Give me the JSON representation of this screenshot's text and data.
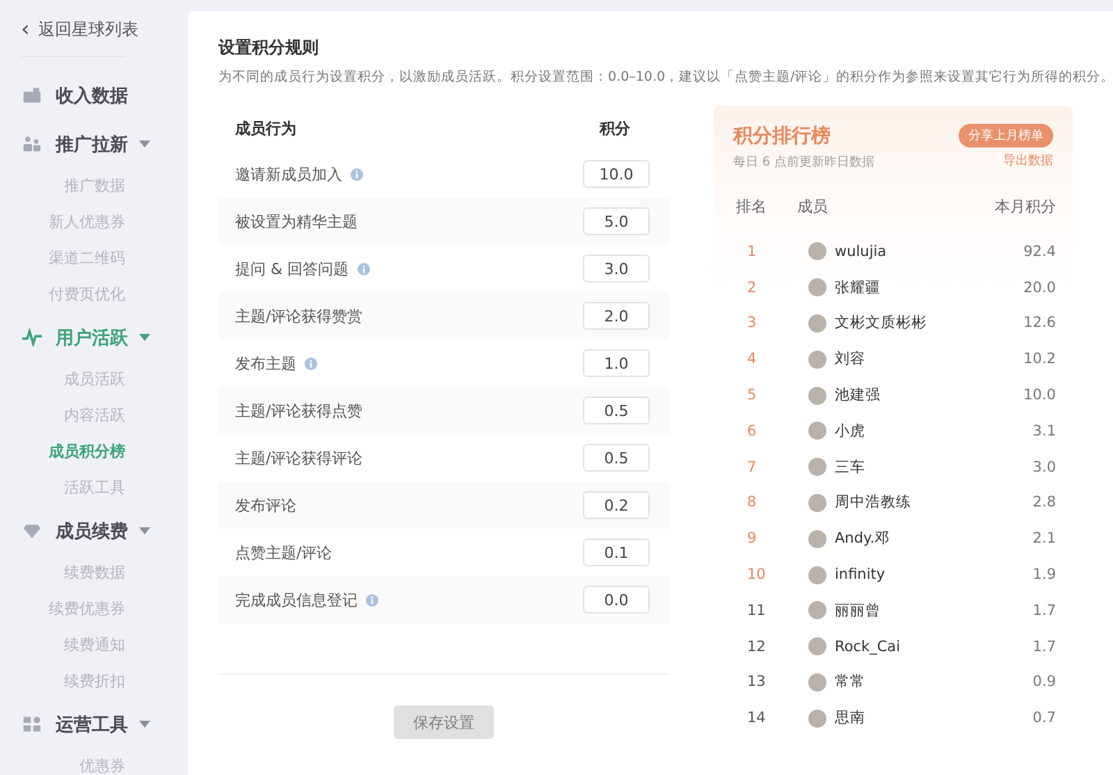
{
  "sidebar": {
    "back": {
      "icon": "‹",
      "label": "返回星球列表"
    },
    "groups": [
      {
        "kind": "income",
        "label": "收入数据",
        "selected": false,
        "expanded": false
      },
      {
        "kind": "people",
        "label": "推广拉新",
        "selected": false,
        "expanded": true,
        "children": [
          {
            "label": "推广数据",
            "selected": false
          },
          {
            "label": "新人优惠券",
            "selected": false
          },
          {
            "label": "渠道二维码",
            "selected": false
          },
          {
            "label": "付费页优化",
            "selected": false
          }
        ]
      },
      {
        "kind": "pulse",
        "label": "用户活跃",
        "selected": true,
        "expanded": true,
        "children": [
          {
            "label": "成员活跃",
            "selected": false
          },
          {
            "label": "内容活跃",
            "selected": false
          },
          {
            "label": "成员积分榜",
            "selected": true
          },
          {
            "label": "活跃工具",
            "selected": false
          }
        ]
      },
      {
        "kind": "gem",
        "label": "成员续费",
        "selected": false,
        "expanded": true,
        "children": [
          {
            "label": "续费数据",
            "selected": false
          },
          {
            "label": "续费优惠券",
            "selected": false
          },
          {
            "label": "续费通知",
            "selected": false
          },
          {
            "label": "续费折扣",
            "selected": false
          }
        ]
      },
      {
        "kind": "grid",
        "label": "运营工具",
        "selected": false,
        "expanded": true,
        "children": [
          {
            "label": "优惠券",
            "selected": false
          }
        ]
      }
    ]
  },
  "rules": {
    "title": "设置积分规则",
    "description": "为不同的成员行为设置积分，以激励成员活跃。积分设置范围：0.0–10.0，建议以「点赞主题/评论」的积分作为参照来设置其它行为所得的积分。",
    "columns": [
      "成员行为",
      "积分"
    ],
    "rows": [
      {
        "action": "邀请新成员加入",
        "info": true,
        "points": "10.0"
      },
      {
        "action": "被设置为精华主题",
        "info": false,
        "points": "5.0"
      },
      {
        "action": "提问 & 回答问题",
        "info": true,
        "points": "3.0"
      },
      {
        "action": "主题/评论获得赞赏",
        "info": false,
        "points": "2.0"
      },
      {
        "action": "发布主题",
        "info": true,
        "points": "1.0"
      },
      {
        "action": "主题/评论获得点赞",
        "info": false,
        "points": "0.5"
      },
      {
        "action": "主题/评论获得评论",
        "info": false,
        "points": "0.5"
      },
      {
        "action": "发布评论",
        "info": false,
        "points": "0.2"
      },
      {
        "action": "点赞主题/评论",
        "info": false,
        "points": "0.1"
      },
      {
        "action": "完成成员信息登记",
        "info": true,
        "points": "0.0"
      }
    ],
    "save_button": {
      "label": "保存设置",
      "disabled": true
    }
  },
  "leaderboard": {
    "title": "积分排行榜",
    "subtitle": "每日 6 点前更新昨日数据",
    "share_button": "分享上月榜单",
    "export_link": "导出数据",
    "columns": [
      "排名",
      "成员",
      "本月积分"
    ],
    "rows": [
      {
        "rank": "1",
        "name": "wulujia",
        "score": "92.4",
        "top": true
      },
      {
        "rank": "2",
        "name": "张耀疆",
        "score": "20.0",
        "top": true
      },
      {
        "rank": "3",
        "name": "文彬文质彬彬",
        "score": "12.6",
        "top": true
      },
      {
        "rank": "4",
        "name": "刘容",
        "score": "10.2",
        "top": true
      },
      {
        "rank": "5",
        "name": "池建强",
        "score": "10.0",
        "top": true
      },
      {
        "rank": "6",
        "name": "小虎",
        "score": "3.1",
        "top": true
      },
      {
        "rank": "7",
        "name": "三车",
        "score": "3.0",
        "top": true
      },
      {
        "rank": "8",
        "name": "周中浩教练",
        "score": "2.8",
        "top": true
      },
      {
        "rank": "9",
        "name": "Andy.邓",
        "score": "2.1",
        "top": true
      },
      {
        "rank": "10",
        "name": "infinity",
        "score": "1.9",
        "top": true
      },
      {
        "rank": "11",
        "name": "丽丽曾",
        "score": "1.7",
        "top": false
      },
      {
        "rank": "12",
        "name": "Rock_Cai",
        "score": "1.7",
        "top": false
      },
      {
        "rank": "13",
        "name": "常常",
        "score": "0.9",
        "top": false
      },
      {
        "rank": "14",
        "name": "思南",
        "score": "0.7",
        "top": false
      }
    ]
  }
}
